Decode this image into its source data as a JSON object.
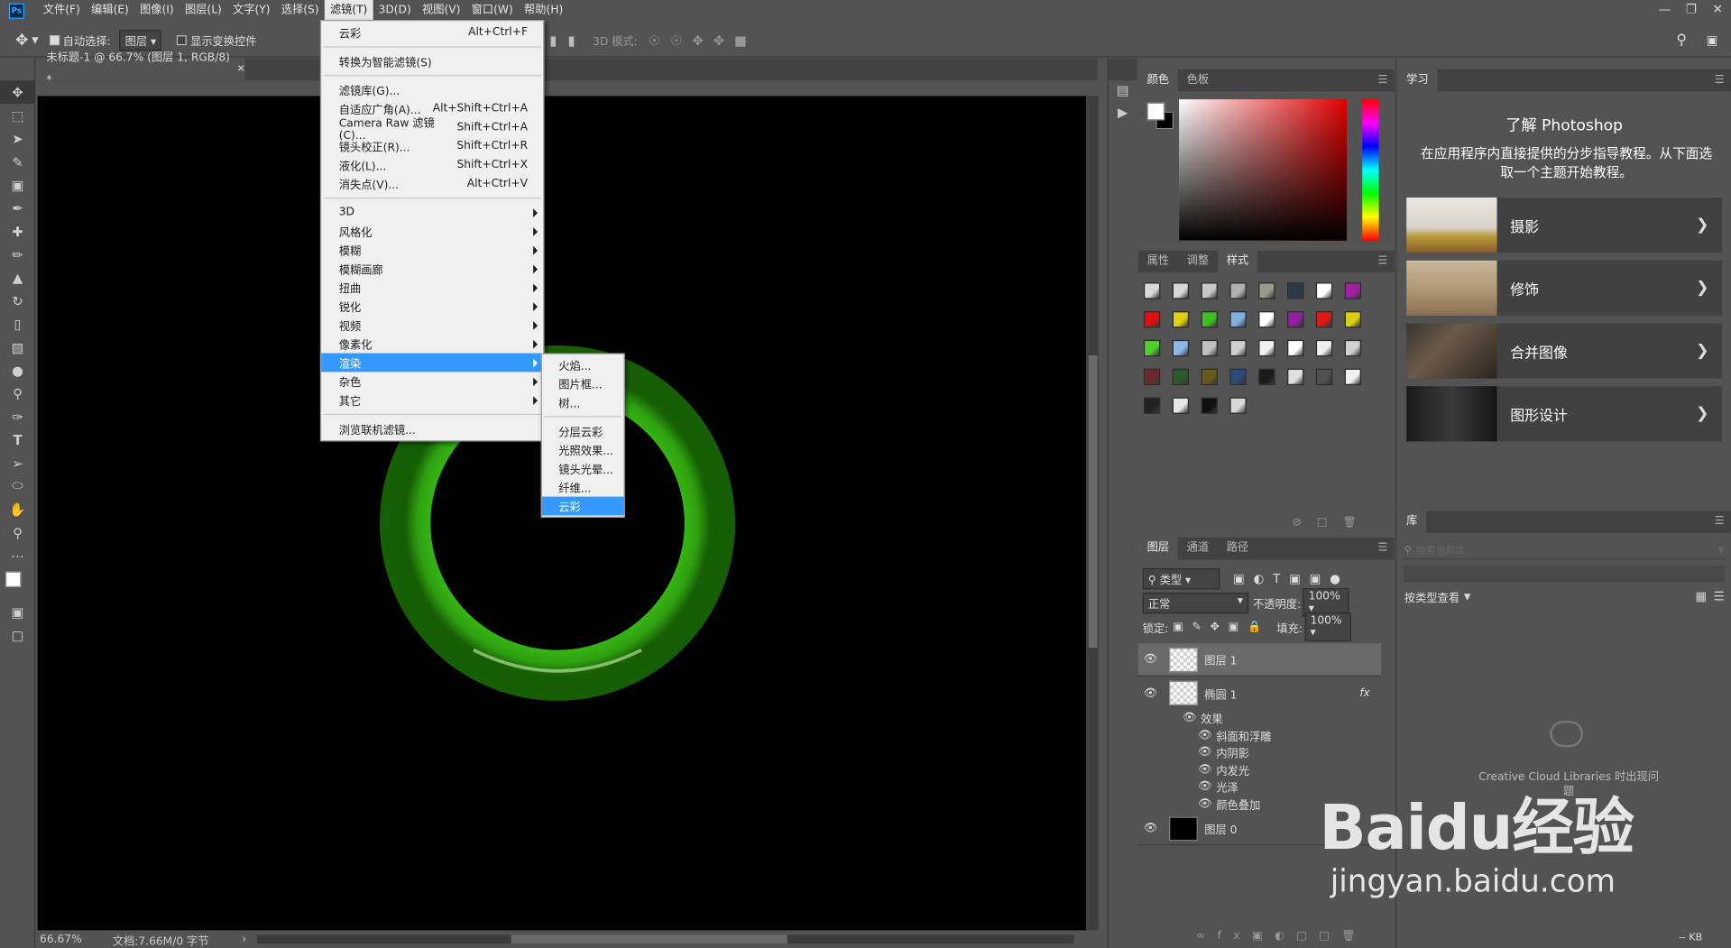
{
  "app": {
    "logo": "Ps"
  },
  "menubar": {
    "items": [
      "文件(F)",
      "编辑(E)",
      "图像(I)",
      "图层(L)",
      "文字(Y)",
      "选择(S)",
      "滤镜(T)",
      "3D(D)",
      "视图(V)",
      "窗口(W)",
      "帮助(H)"
    ],
    "active_index": 6
  },
  "options": {
    "auto_select_label": "自动选择:",
    "auto_select_value": "图层",
    "show_transform_label": "显示变换控件",
    "mode_3d_label": "3D 模式:"
  },
  "document": {
    "tab_title": "未标题-1 @ 66.7% (图层 1, RGB/8) *",
    "zoom": "66.67%",
    "doc_info": "文档:7.66M/0 字节",
    "ring_color": "#2fa010"
  },
  "filter_menu": {
    "items": [
      {
        "label": "云彩",
        "shortcut": "Alt+Ctrl+F"
      },
      {
        "sep": true
      },
      {
        "label": "转换为智能滤镜(S)",
        "shortcut": ""
      },
      {
        "sep": true
      },
      {
        "label": "滤镜库(G)...",
        "shortcut": ""
      },
      {
        "label": "自适应广角(A)...",
        "shortcut": "Alt+Shift+Ctrl+A"
      },
      {
        "label": "Camera Raw 滤镜(C)...",
        "shortcut": "Shift+Ctrl+A"
      },
      {
        "label": "镜头校正(R)...",
        "shortcut": "Shift+Ctrl+R"
      },
      {
        "label": "液化(L)...",
        "shortcut": "Shift+Ctrl+X"
      },
      {
        "label": "消失点(V)...",
        "shortcut": "Alt+Ctrl+V"
      },
      {
        "sep": true
      },
      {
        "label": "3D",
        "sub": true
      },
      {
        "label": "风格化",
        "sub": true
      },
      {
        "label": "模糊",
        "sub": true
      },
      {
        "label": "模糊画廊",
        "sub": true
      },
      {
        "label": "扭曲",
        "sub": true
      },
      {
        "label": "锐化",
        "sub": true
      },
      {
        "label": "视频",
        "sub": true
      },
      {
        "label": "像素化",
        "sub": true
      },
      {
        "label": "渲染",
        "sub": true,
        "highlight": true
      },
      {
        "label": "杂色",
        "sub": true
      },
      {
        "label": "其它",
        "sub": true
      },
      {
        "sep": true
      },
      {
        "label": "浏览联机滤镜...",
        "shortcut": ""
      }
    ]
  },
  "render_submenu": {
    "items": [
      {
        "label": "火焰..."
      },
      {
        "label": "图片框..."
      },
      {
        "label": "树..."
      },
      {
        "sep": true
      },
      {
        "label": "分层云彩"
      },
      {
        "label": "光照效果..."
      },
      {
        "label": "镜头光晕..."
      },
      {
        "label": "纤维..."
      },
      {
        "label": "云彩",
        "highlight": true
      }
    ]
  },
  "color_panel": {
    "tabs": [
      "颜色",
      "色板"
    ]
  },
  "styles_panel": {
    "tabs": [
      "属性",
      "调整",
      "样式"
    ],
    "swatches": [
      "#d8d8d8",
      "#d8d8d8",
      "#c8c8c8",
      "#b0b0b0",
      "#9a9a8a",
      "#2b3a4a",
      "#ffffff",
      "#a020a0",
      "#e01010",
      "#e0d010",
      "#40c020",
      "#80b0e0",
      "#ffffff",
      "#9020a0",
      "#e01818",
      "#d8d010",
      "#50d030",
      "#8ab8e8",
      "#c0c0c0",
      "#d0d0d0",
      "#f0f0f0",
      "#ffffff",
      "#f0f0f0",
      "#d0d0d0",
      "#6a2a2a",
      "#2a5a2a",
      "#6a5a1a",
      "#2a4a7a",
      "#1a1a1a",
      "#e0e0e0",
      "#505050",
      "#f0f0f0",
      "#202020",
      "#e8e8e8",
      "#101010",
      "#d8d8d8"
    ]
  },
  "layers_panel": {
    "tabs": [
      "图层",
      "通道",
      "路径"
    ],
    "filter_kind": "类型",
    "blend_mode": "正常",
    "opacity_label": "不透明度:",
    "opacity_value": "100%",
    "lock_label": "锁定:",
    "fill_label": "填充:",
    "fill_value": "100%",
    "layers": [
      {
        "name": "图层 1",
        "selected": true
      },
      {
        "name": "椭圆 1",
        "fx": "fx"
      },
      {
        "name": "图层 0"
      }
    ],
    "effects_label": "效果",
    "effects": [
      "斜面和浮雕",
      "内阴影",
      "内发光",
      "光泽",
      "颜色叠加"
    ]
  },
  "learn_panel": {
    "tab": "学习",
    "title": "了解 Photoshop",
    "desc": "在应用程序内直接提供的分步指导教程。从下面选取一个主题开始教程。",
    "topics": [
      "摄影",
      "修饰",
      "合并图像",
      "图形设计"
    ]
  },
  "library_panel": {
    "tab": "库",
    "search_placeholder": "搜索当前库",
    "view_label": "按类型查看",
    "cc_text": "Creative Cloud Libraries 时出现问题",
    "size": "-- KB"
  },
  "watermark": {
    "brand": "Baidu经验",
    "url": "jingyan.baidu.com"
  }
}
